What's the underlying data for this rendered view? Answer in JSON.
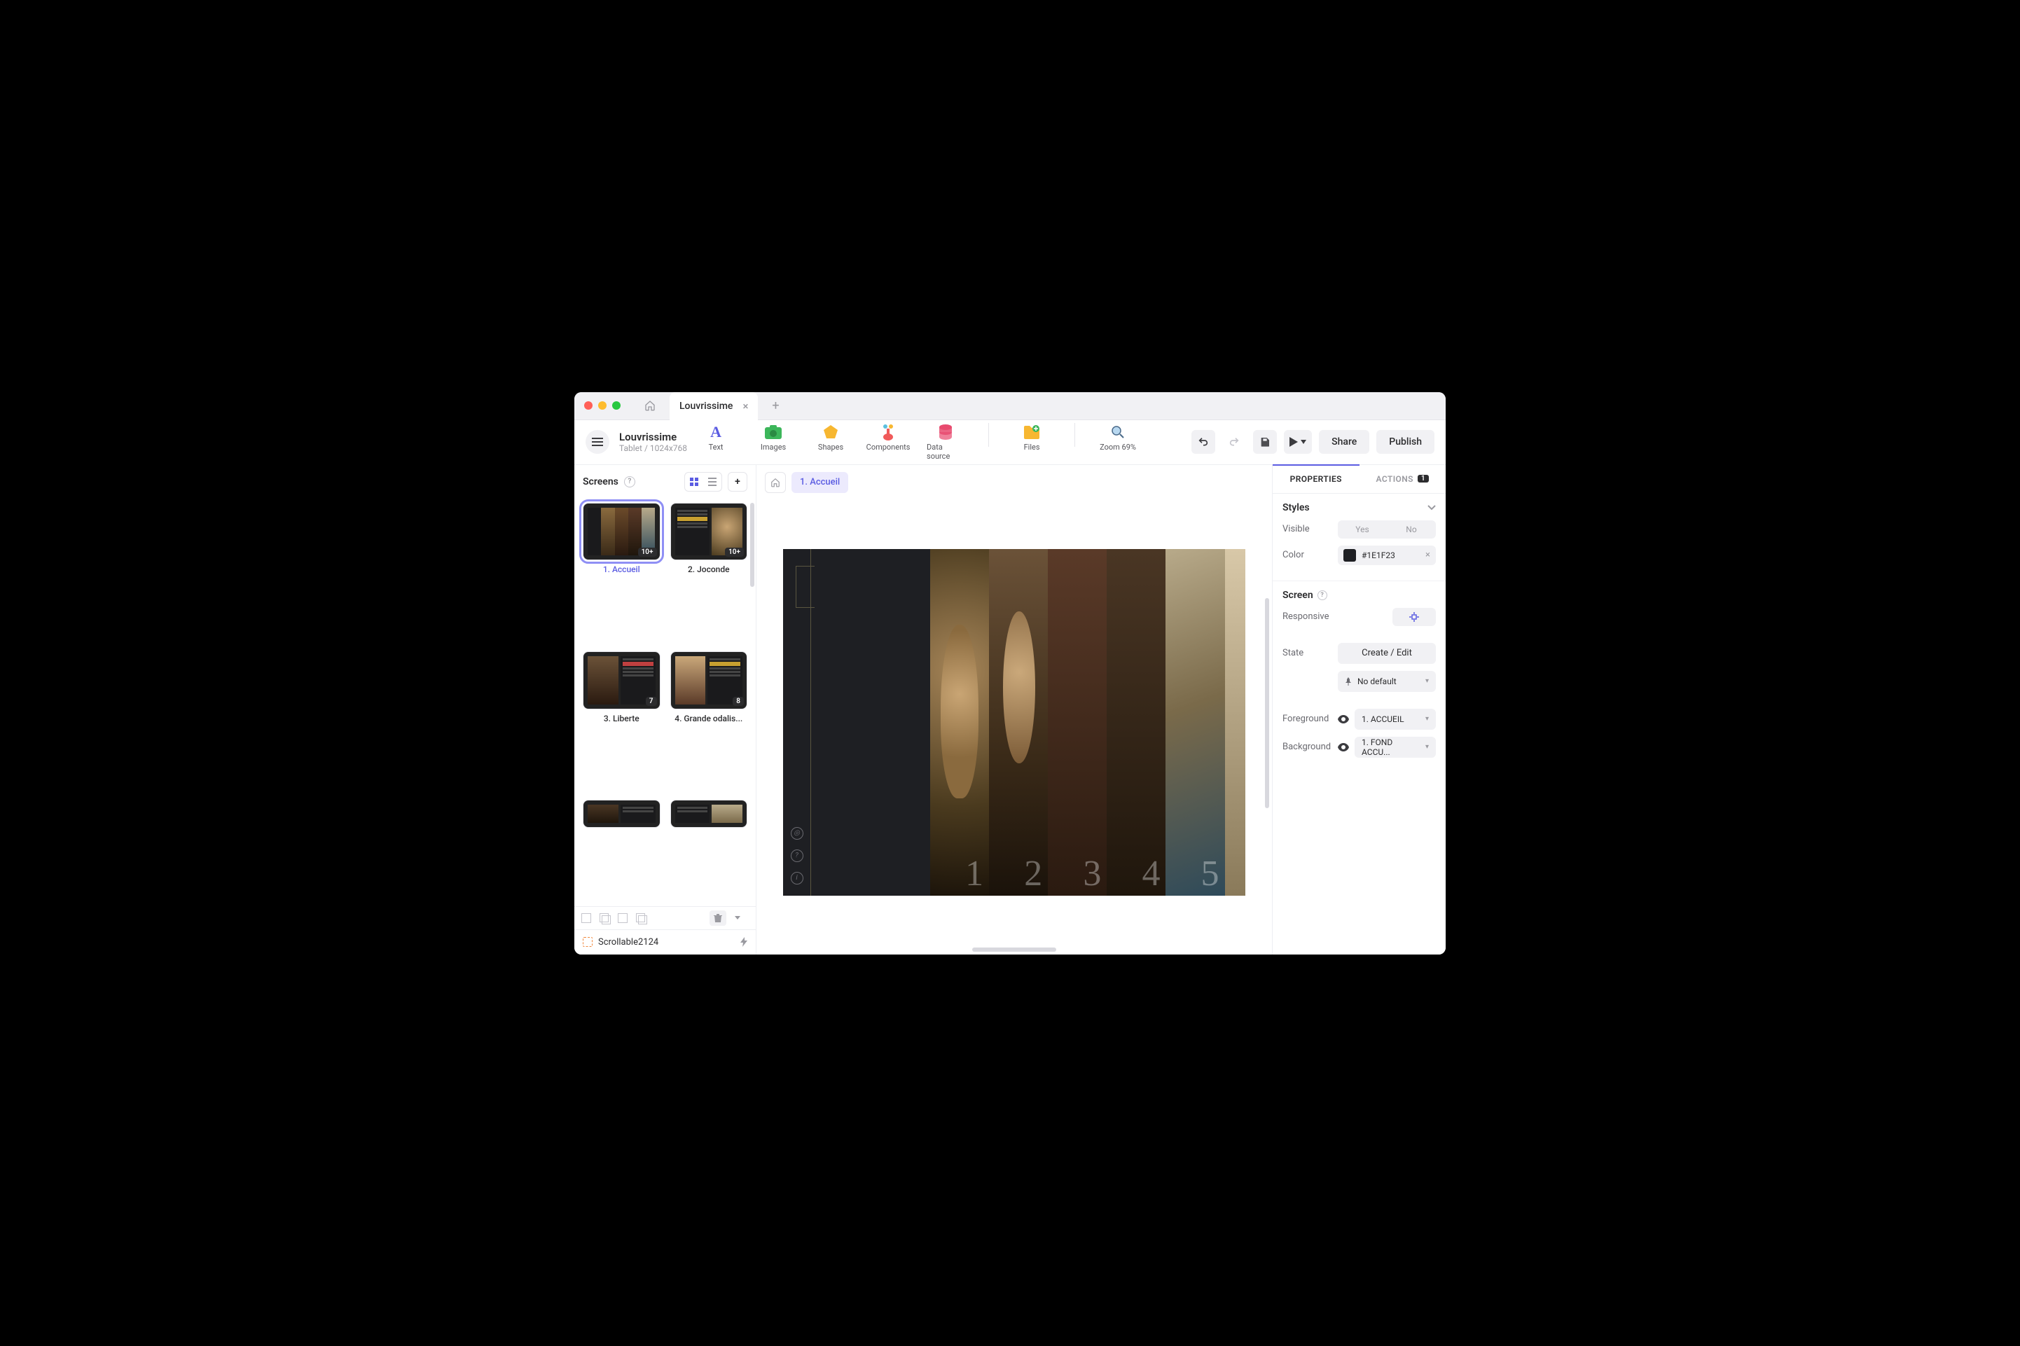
{
  "window": {
    "tab_label": "Louvrissime"
  },
  "project": {
    "name": "Louvrissime",
    "subtitle": "Tablet / 1024x768"
  },
  "toolbar": {
    "text": "Text",
    "images": "Images",
    "shapes": "Shapes",
    "components": "Components",
    "datasource": "Data source",
    "files": "Files",
    "zoom": "Zoom 69%",
    "share": "Share",
    "publish": "Publish"
  },
  "screens": {
    "title": "Screens",
    "items": [
      {
        "label": "1. Accueil",
        "badge": "10+",
        "selected": true
      },
      {
        "label": "2. Joconde",
        "badge": "10+"
      },
      {
        "label": "3. Liberte",
        "badge": "7"
      },
      {
        "label": "4. Grande odalis...",
        "badge": "8"
      },
      {
        "label": "",
        "badge": ""
      },
      {
        "label": "",
        "badge": ""
      }
    ]
  },
  "tree": {
    "node": "Scrollable2124"
  },
  "breadcrumb": {
    "current": "1. Accueil"
  },
  "canvas": {
    "strip_numbers": [
      "1",
      "2",
      "3",
      "4",
      "5"
    ]
  },
  "panel": {
    "tab_properties": "PROPERTIES",
    "tab_actions": "ACTIONS",
    "actions_count": "1",
    "styles_title": "Styles",
    "visible_label": "Visible",
    "visible_yes": "Yes",
    "visible_no": "No",
    "color_label": "Color",
    "color_value": "#1E1F23",
    "screen_title": "Screen",
    "responsive_label": "Responsive",
    "state_label": "State",
    "state_btn": "Create / Edit",
    "state_default": "No default",
    "foreground_label": "Foreground",
    "foreground_value": "1. ACCUEIL",
    "background_label": "Background",
    "background_value": "1. FOND ACCU..."
  }
}
